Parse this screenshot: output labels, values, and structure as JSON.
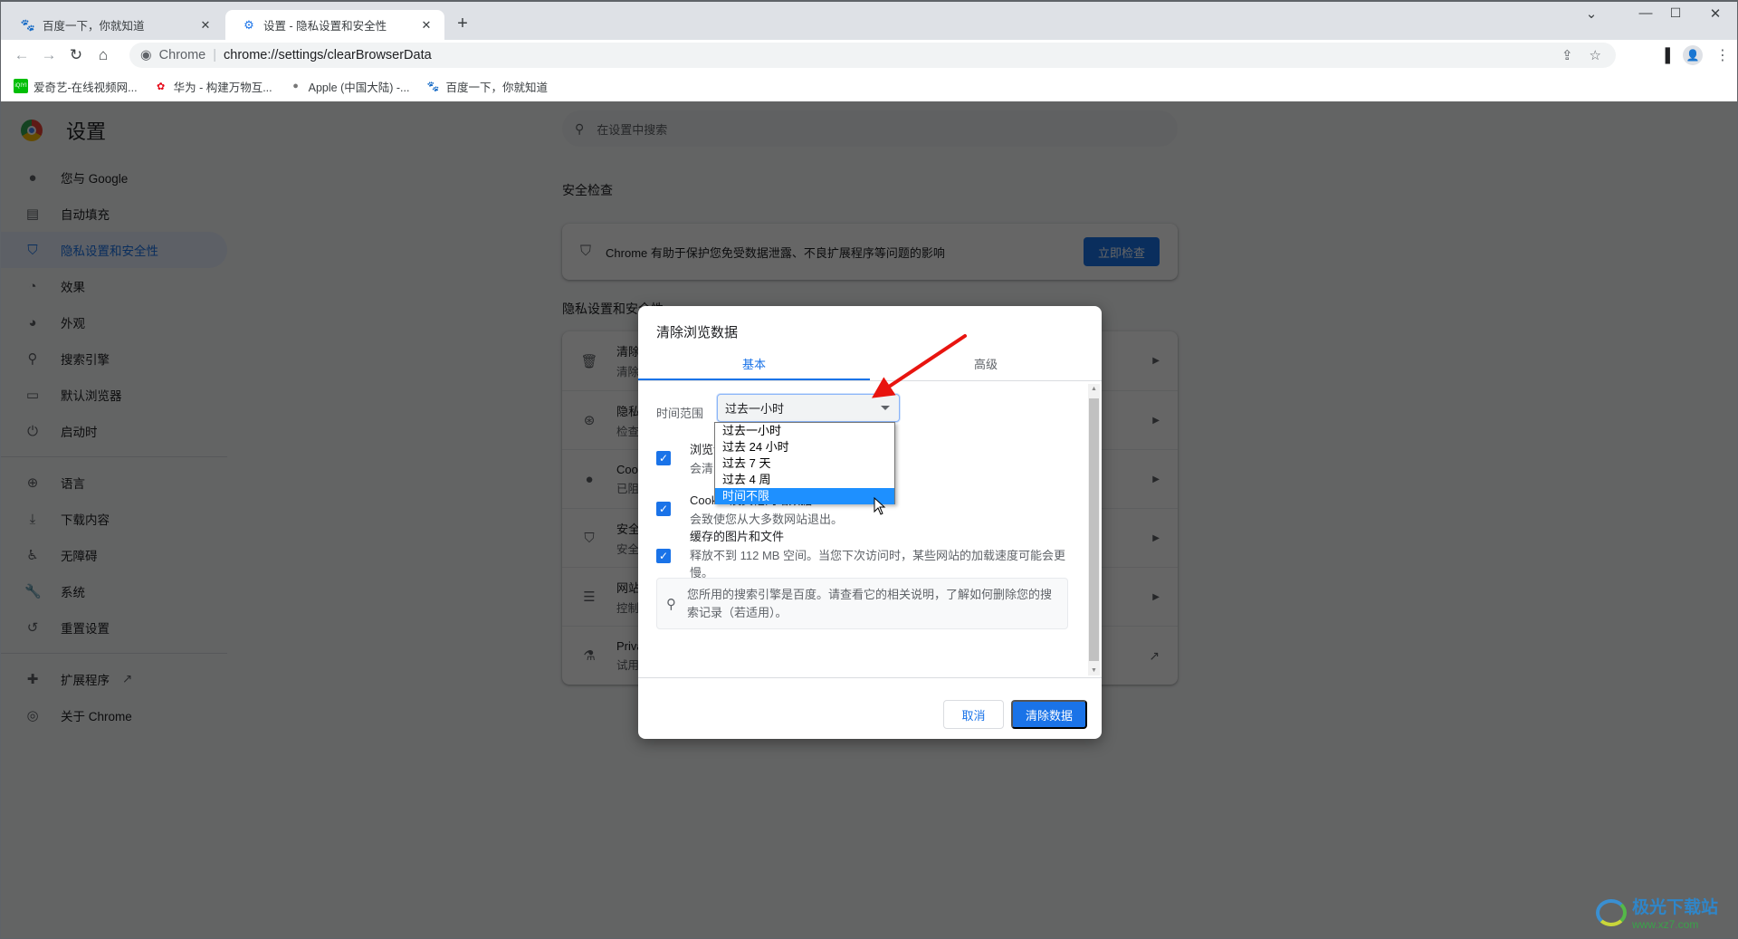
{
  "browser": {
    "tabs": [
      {
        "title": "百度一下，你就知道",
        "favicon": "baidu-paw-icon",
        "active": false
      },
      {
        "title": "设置 - 隐私设置和安全性",
        "favicon": "gear-icon",
        "active": true
      }
    ],
    "new_tab_label": "+",
    "window_controls": [
      "chevron-down",
      "minimize",
      "maximize",
      "close"
    ],
    "omnibox": {
      "site_label": "Chrome",
      "url": "chrome://settings/clearBrowserData"
    },
    "bookmarks": [
      {
        "label": "爱奇艺-在线视频网...",
        "icon": "iqiyi-icon"
      },
      {
        "label": "华为 - 构建万物互...",
        "icon": "huawei-icon"
      },
      {
        "label": "Apple (中国大陆) -...",
        "icon": "apple-icon"
      },
      {
        "label": "百度一下，你就知道",
        "icon": "baidu-paw-icon"
      }
    ]
  },
  "settings": {
    "title": "设置",
    "search_placeholder": "在设置中搜索",
    "nav": [
      {
        "label": "您与 Google",
        "icon": "person-icon"
      },
      {
        "label": "自动填充",
        "icon": "clipboard-icon"
      },
      {
        "label": "隐私设置和安全性",
        "icon": "shield-icon",
        "active": true
      },
      {
        "label": "效果",
        "icon": "speedometer-icon"
      },
      {
        "label": "外观",
        "icon": "palette-icon"
      },
      {
        "label": "搜索引擎",
        "icon": "search-icon"
      },
      {
        "label": "默认浏览器",
        "icon": "browser-icon"
      },
      {
        "label": "启动时",
        "icon": "power-icon"
      },
      {
        "label": "语言",
        "icon": "globe-icon"
      },
      {
        "label": "下载内容",
        "icon": "download-icon"
      },
      {
        "label": "无障碍",
        "icon": "accessibility-icon"
      },
      {
        "label": "系统",
        "icon": "wrench-icon"
      },
      {
        "label": "重置设置",
        "icon": "restore-icon"
      },
      {
        "label": "扩展程序",
        "icon": "puzzle-icon"
      },
      {
        "label": "关于 Chrome",
        "icon": "chrome-icon"
      }
    ],
    "safety_check": {
      "section_title": "安全检查",
      "text": "Chrome 有助于保护您免受数据泄露、不良扩展程序等问题的影响",
      "button": "立即检查"
    },
    "privacy": {
      "section_title": "隐私设置和安全性",
      "rows": [
        {
          "title": "清除",
          "sub": "清除",
          "icon": "trash-icon"
        },
        {
          "title": "隐私",
          "sub": "检查",
          "icon": "privacy-guide-icon"
        },
        {
          "title": "Cook",
          "sub": "已阻",
          "icon": "cookie-icon"
        },
        {
          "title": "安全",
          "sub": "安全",
          "icon": "shield-icon"
        },
        {
          "title": "网站",
          "sub": "控制",
          "icon": "tune-icon"
        },
        {
          "title": "Priva",
          "sub": "试用",
          "icon": "flask-icon"
        }
      ]
    }
  },
  "dialog": {
    "title": "清除浏览数据",
    "tabs": [
      {
        "label": "基本",
        "active": true
      },
      {
        "label": "高级",
        "active": false
      }
    ],
    "time_range_label": "时间范围",
    "time_range_value": "过去一小时",
    "time_range_options": [
      "过去一小时",
      "过去 24 小时",
      "过去 7 天",
      "过去 4 周",
      "时间不限"
    ],
    "highlighted_option": "时间不限",
    "items": [
      {
        "title": "浏览记录",
        "desc": "会清除所有已登录设备中的历史记录",
        "checked": true
      },
      {
        "title": "Cookie 及其他网站数据",
        "desc": "会致使您从大多数网站退出。",
        "checked": true
      },
      {
        "title": "缓存的图片和文件",
        "desc": "释放不到 112 MB 空间。当您下次访问时，某些网站的加载速度可能会更慢。",
        "checked": true
      }
    ],
    "info": "您所用的搜索引擎是百度。请查看它的相关说明，了解如何删除您的搜索记录（若适用）。",
    "cancel_label": "取消",
    "confirm_label": "清除数据"
  },
  "annotation": {
    "type": "red-arrow",
    "color": "#e8140f",
    "points_to": "time-range-select"
  },
  "watermark": {
    "title": "极光下载站",
    "url": "www.xz7.com"
  }
}
